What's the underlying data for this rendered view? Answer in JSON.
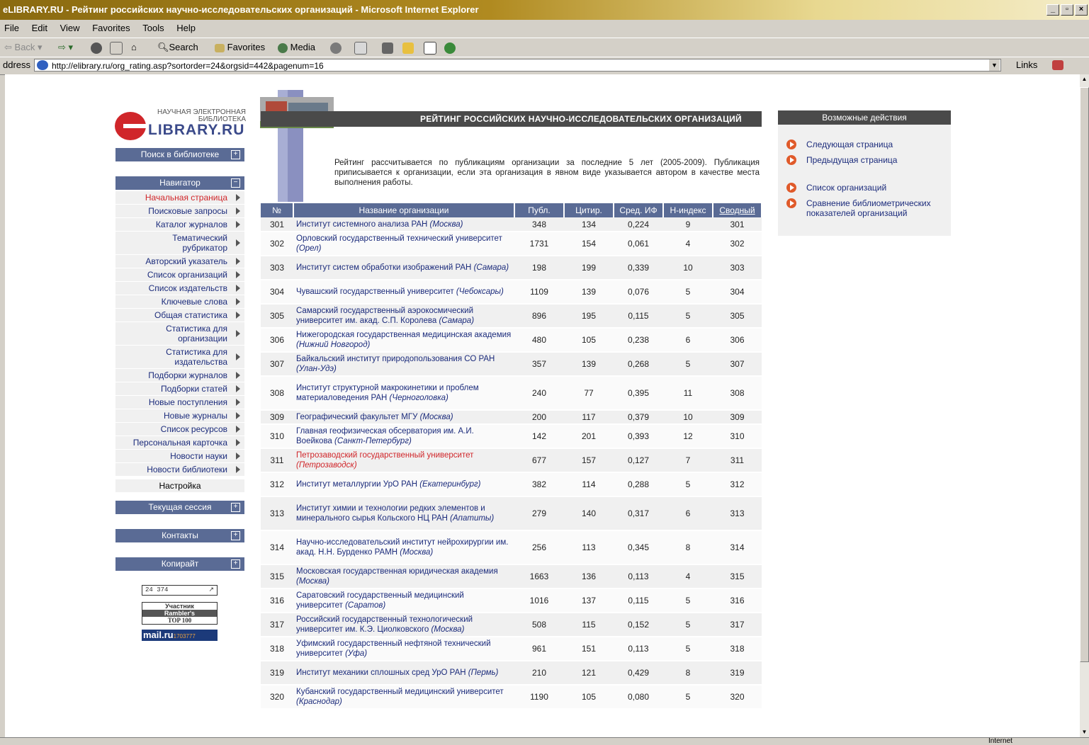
{
  "window": {
    "title": "eLIBRARY.RU - Рейтинг российских научно-исследовательских организаций - Microsoft Internet Explorer"
  },
  "menu": [
    "File",
    "Edit",
    "View",
    "Favorites",
    "Tools",
    "Help"
  ],
  "toolbar": {
    "back": "Back",
    "search": "Search",
    "favorites": "Favorites",
    "media": "Media"
  },
  "address": {
    "label": "ddress",
    "url": "http://elibrary.ru/org_rating.asp?sortorder=24&orgsid=442&pagenum=16",
    "links": "Links"
  },
  "status": {
    "zone": "Internet"
  },
  "logo": {
    "tagline": "НАУЧНАЯ ЭЛЕКТРОННАЯ БИБЛИОТЕКА",
    "name": "LIBRARY.RU"
  },
  "left": {
    "search_bar": "Поиск в библиотеке",
    "navigator": "Навигатор",
    "nav": [
      "Начальная страница",
      "Поисковые запросы",
      "Каталог журналов",
      "Тематический рубрикатор",
      "Авторский указатель",
      "Список организаций",
      "Список издательств",
      "Ключевые слова",
      "Общая статистика",
      "Статистика для организации",
      "Статистика для издательства",
      "Подборки журналов",
      "Подборки статей",
      "Новые поступления",
      "Новые журналы",
      "Список ресурсов",
      "Персональная карточка",
      "Новости науки",
      "Новости библиотеки"
    ],
    "settings": "Настройка",
    "session": "Текущая сессия",
    "contacts": "Контакты",
    "copyright": "Копирайт",
    "counter": "24 374",
    "rambler": [
      "Участник",
      "Rambler's",
      "TOP 100"
    ],
    "mail": "mail.ru",
    "mail_count": "1703777"
  },
  "main": {
    "header": "РЕЙТИНГ РОССИЙСКИХ НАУЧНО-ИССЛЕДОВАТЕЛЬСКИХ ОРГАНИЗАЦИЙ",
    "description": "Рейтинг рассчитывается по публикациям организации за последние 5 лет (2005-2009). Публикация приписывается к организации, если эта организация в явном виде указывается автором в качестве места выполнения работы.",
    "columns": [
      "№",
      "Название организации",
      "Публ.",
      "Цитир.",
      "Сред. ИФ",
      "H-индекс",
      "Сводный"
    ],
    "rows": [
      {
        "n": "301",
        "name": "Институт системного анализа РАН",
        "city": "(Москва)",
        "pub": "348",
        "cit": "134",
        "if": "0,224",
        "h": "9",
        "sum": "301"
      },
      {
        "n": "302",
        "name": "Орловский государственный технический университет",
        "city": "(Орел)",
        "pub": "1731",
        "cit": "154",
        "if": "0,061",
        "h": "4",
        "sum": "302"
      },
      {
        "n": "303",
        "name": "Институт систем обработки изображений РАН",
        "city": "(Самара)",
        "pub": "198",
        "cit": "199",
        "if": "0,339",
        "h": "10",
        "sum": "303"
      },
      {
        "n": "304",
        "name": "Чувашский государственный университет",
        "city": "(Чебоксары)",
        "pub": "1109",
        "cit": "139",
        "if": "0,076",
        "h": "5",
        "sum": "304"
      },
      {
        "n": "305",
        "name": "Самарский государственный аэрокосмический университет им. акад. С.П. Королева",
        "city": "(Самара)",
        "pub": "896",
        "cit": "195",
        "if": "0,115",
        "h": "5",
        "sum": "305"
      },
      {
        "n": "306",
        "name": "Нижегородская государственная медицинская академия",
        "city": "(Нижний Новгород)",
        "pub": "480",
        "cit": "105",
        "if": "0,238",
        "h": "6",
        "sum": "306"
      },
      {
        "n": "307",
        "name": "Байкальский институт природопользования СО РАН",
        "city": "(Улан-Удэ)",
        "pub": "357",
        "cit": "139",
        "if": "0,268",
        "h": "5",
        "sum": "307"
      },
      {
        "n": "308",
        "name": "Институт структурной макрокинетики и проблем материаловедения РАН",
        "city": "(Черноголовка)",
        "pub": "240",
        "cit": "77",
        "if": "0,395",
        "h": "11",
        "sum": "308"
      },
      {
        "n": "309",
        "name": "Географический факультет МГУ",
        "city": "(Москва)",
        "pub": "200",
        "cit": "117",
        "if": "0,379",
        "h": "10",
        "sum": "309"
      },
      {
        "n": "310",
        "name": "Главная геофизическая обсерватория им. А.И. Воейкова",
        "city": "(Санкт-Петербург)",
        "pub": "142",
        "cit": "201",
        "if": "0,393",
        "h": "12",
        "sum": "310"
      },
      {
        "n": "311",
        "name": "Петрозаводский государственный университет",
        "city": "(Петрозаводск)",
        "pub": "677",
        "cit": "157",
        "if": "0,127",
        "h": "7",
        "sum": "311",
        "highlight": true
      },
      {
        "n": "312",
        "name": "Институт металлургии УрО РАН",
        "city": "(Екатеринбург)",
        "pub": "382",
        "cit": "114",
        "if": "0,288",
        "h": "5",
        "sum": "312"
      },
      {
        "n": "313",
        "name": "Институт химии и технологии редких элементов и минерального сырья Кольского НЦ РАН",
        "city": "(Апатиты)",
        "pub": "279",
        "cit": "140",
        "if": "0,317",
        "h": "6",
        "sum": "313"
      },
      {
        "n": "314",
        "name": "Научно-исследовательский институт нейрохирургии им. акад. Н.Н. Бурденко РАМН",
        "city": "(Москва)",
        "pub": "256",
        "cit": "113",
        "if": "0,345",
        "h": "8",
        "sum": "314"
      },
      {
        "n": "315",
        "name": "Московская государственная юридическая академия",
        "city": "(Москва)",
        "pub": "1663",
        "cit": "136",
        "if": "0,113",
        "h": "4",
        "sum": "315"
      },
      {
        "n": "316",
        "name": "Саратовский государственный медицинский университет",
        "city": "(Саратов)",
        "pub": "1016",
        "cit": "137",
        "if": "0,115",
        "h": "5",
        "sum": "316"
      },
      {
        "n": "317",
        "name": "Российский государственный технологический университет им. К.Э. Циолковского",
        "city": "(Москва)",
        "pub": "508",
        "cit": "115",
        "if": "0,152",
        "h": "5",
        "sum": "317"
      },
      {
        "n": "318",
        "name": "Уфимский государственный нефтяной технический университет",
        "city": "(Уфа)",
        "pub": "961",
        "cit": "151",
        "if": "0,113",
        "h": "5",
        "sum": "318"
      },
      {
        "n": "319",
        "name": "Институт механики сплошных сред УрО РАН",
        "city": "(Пермь)",
        "pub": "210",
        "cit": "121",
        "if": "0,429",
        "h": "8",
        "sum": "319"
      },
      {
        "n": "320",
        "name": "Кубанский государственный медицинский университет",
        "city": "(Краснодар)",
        "pub": "1190",
        "cit": "105",
        "if": "0,080",
        "h": "5",
        "sum": "320"
      }
    ]
  },
  "actions": {
    "title": "Возможные действия",
    "items": [
      "Следующая страница",
      "Предыдущая страница",
      "Список организаций",
      "Сравнение библиометрических показателей организаций"
    ]
  }
}
